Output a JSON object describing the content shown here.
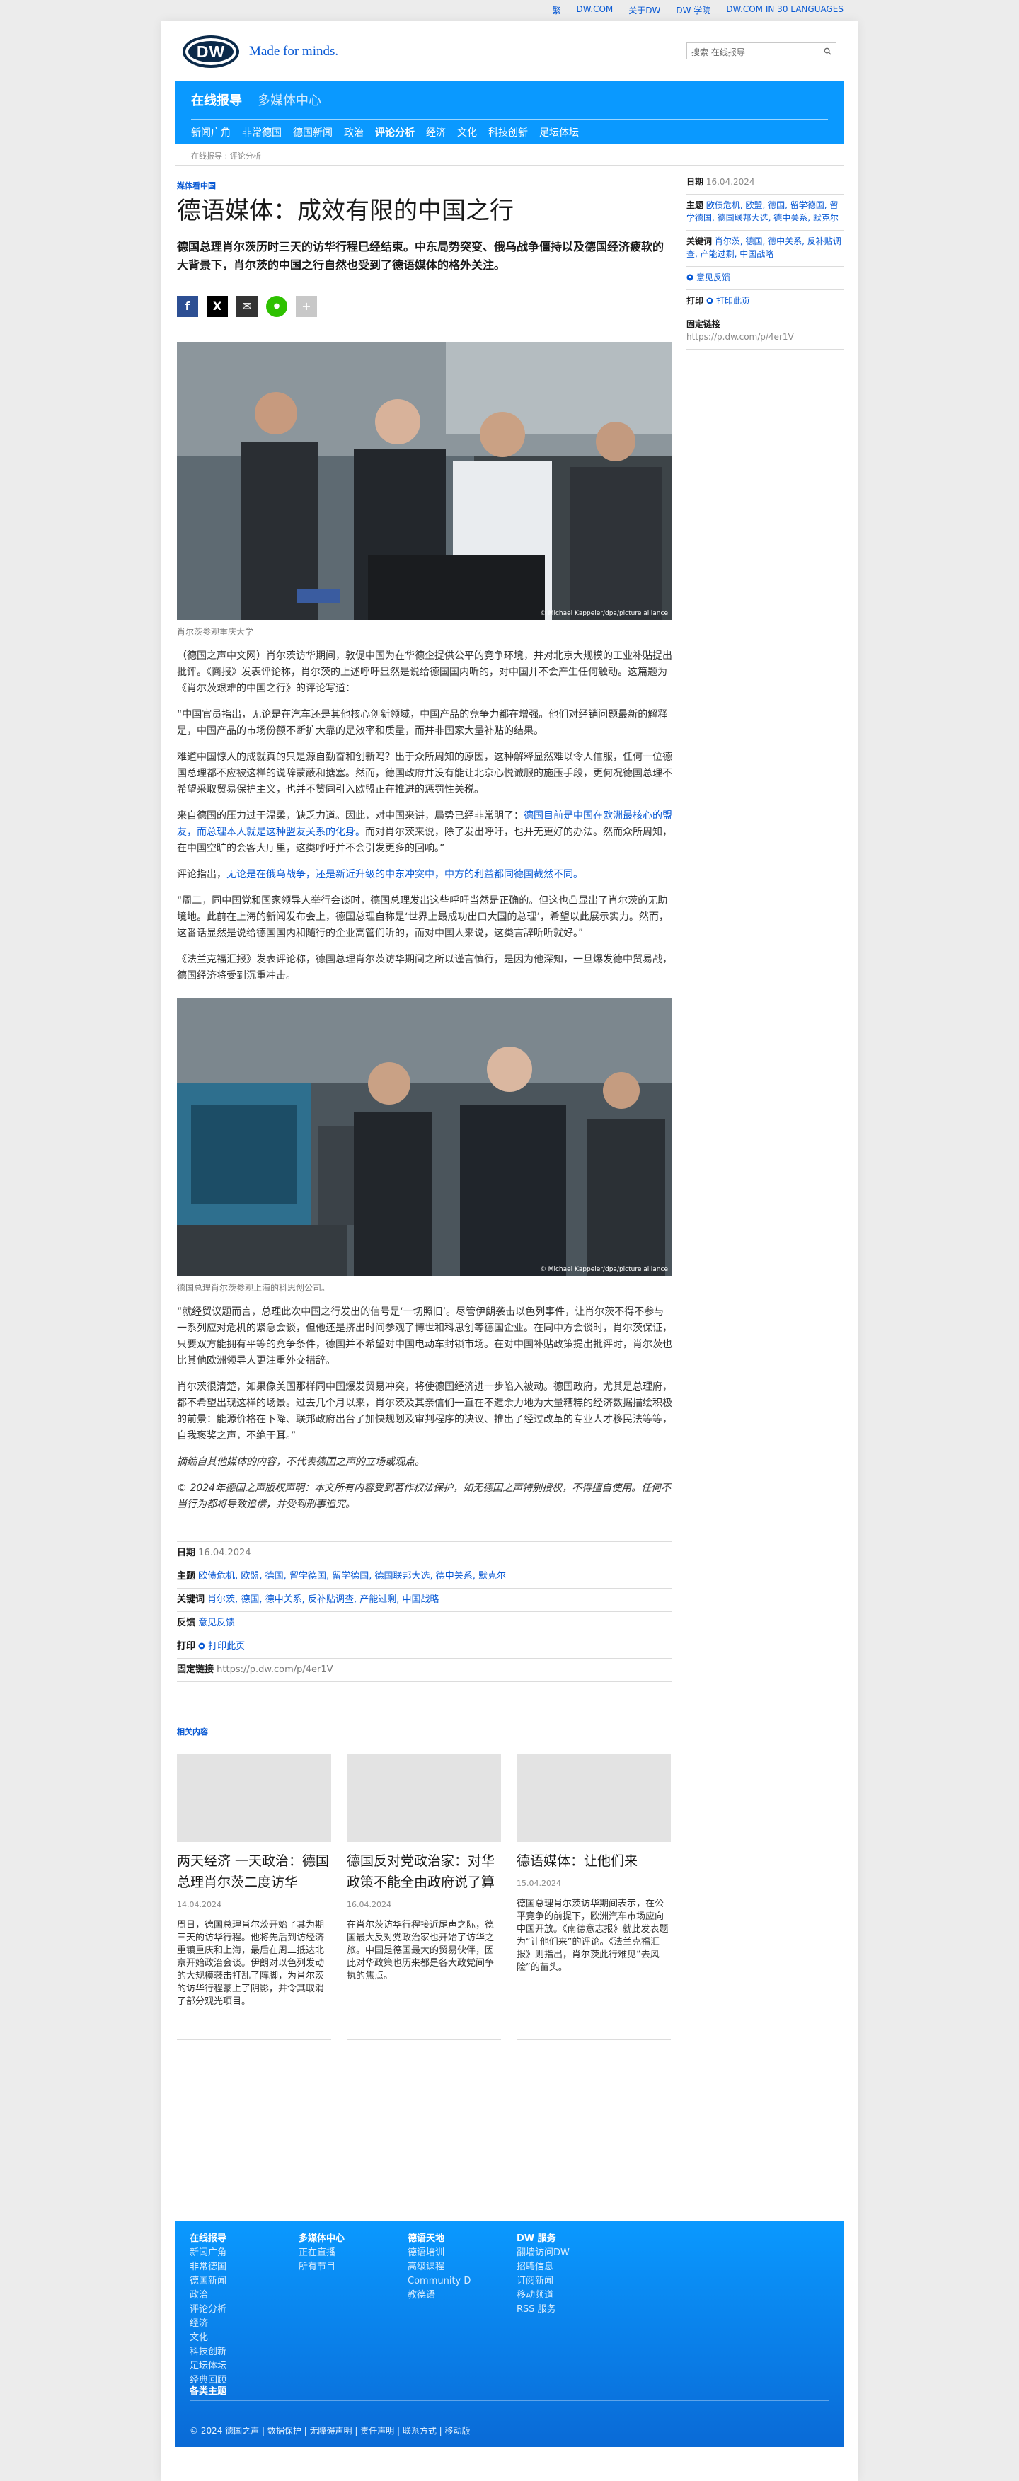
{
  "topbar": {
    "links": [
      "繁",
      "DW.COM",
      "关于DW",
      "DW 学院",
      "DW.COM IN 30 LANGUAGES"
    ]
  },
  "header": {
    "logo_text": "DW",
    "tagline": "Made for minds.",
    "search_placeholder": "搜索 在线报导"
  },
  "nav": {
    "sections": [
      "在线报导",
      "多媒体中心"
    ],
    "items": [
      "新闻广角",
      "非常德国",
      "德国新闻",
      "政治",
      "评论分析",
      "经济",
      "文化",
      "科技创新",
      "足坛体坛"
    ]
  },
  "breadcrumb": "在线报导 : 评论分析",
  "article": {
    "kicker": "媒体看中国",
    "title": "德语媒体：成效有限的中国之行",
    "lead": "德国总理肖尔茨历时三天的访华行程已经结束。中东局势突变、俄乌战争僵持以及德国经济疲软的大背景下，肖尔茨的中国之行自然也受到了德语媒体的格外关注。",
    "share": {
      "facebook": "f",
      "x": "X",
      "email": "✉",
      "line": "●",
      "more": "+"
    },
    "photo1": {
      "credit": "© Michael Kappeler/dpa/picture alliance",
      "caption": "肖尔茨参观重庆大学"
    },
    "p1": "（德国之声中文网）肖尔茨访华期间，敦促中国为在华德企提供公平的竞争环境，并对北京大规模的工业补贴提出批评。《商报》发表评论称，肖尔茨的上述呼吁显然是说给德国国内听的，对中国并不会产生任何触动。这篇题为《肖尔茨艰难的中国之行》的评论写道：",
    "p2": "“中国官员指出，无论是在汽车还是其他核心创新领域，中国产品的竞争力都在增强。他们对经销问题最新的解释是，中国产品的市场份额不断扩大靠的是效率和质量，而并非国家大量补贴的结果。",
    "p3": "难道中国惊人的成就真的只是源自勤奋和创新吗？出于众所周知的原因，这种解释显然难以令人信服，任何一位德国总理都不应被这样的说辞蒙蔽和搪塞。然而，德国政府并没有能让北京心悦诚服的施压手段，更何况德国总理不希望采取贸易保护主义，也并不赞同引入欧盟正在推进的惩罚性关税。",
    "p4a": "来自德国的压力过于温柔，缺乏力道。因此，对中国来讲，局势已经非常明了：",
    "p4link": "德国目前是中国在欧洲最核心的盟友，而总理本人就是这种盟友关系的化身。",
    "p4b": "而对肖尔茨来说，除了发出呼吁，也并无更好的办法。然而众所周知，在中国空旷的会客大厅里，这类呼吁并不会引发更多的回响。”",
    "p5a": "评论指出，",
    "p5link": "无论是在俄乌战争，还是新近升级的中东冲突中，中方的利益都同德国截然不同。",
    "p6": "“周二，同中国党和国家领导人举行会谈时，德国总理发出这些呼吁当然是正确的。但这也凸显出了肖尔茨的无助境地。此前在上海的新闻发布会上，德国总理自称是‘世界上最成功出口大国的总理’，希望以此展示实力。然而，这番话显然是说给德国国内和随行的企业高管们听的，而对中国人来说，这类言辞听听就好。”",
    "p7": "《法兰克福汇报》发表评论称，德国总理肖尔茨访华期间之所以谨言慎行，是因为他深知，一旦爆发德中贸易战，德国经济将受到沉重冲击。",
    "photo2": {
      "credit": "© Michael Kappeler/dpa/picture alliance",
      "caption": "德国总理肖尔茨参观上海的科思创公司。"
    },
    "p8": "“就经贸议题而言，总理此次中国之行发出的信号是‘一切照旧’。尽管伊朗袭击以色列事件，让肖尔茨不得不参与一系列应对危机的紧急会谈，但他还是挤出时间参观了博世和科思创等德国企业。在同中方会谈时，肖尔茨保证，只要双方能拥有平等的竞争条件，德国并不希望对中国电动车封锁市场。在对中国补贴政策提出批评时，肖尔茨也比其他欧洲领导人更注重外交措辞。",
    "p9": "肖尔茨很清楚，如果像美国那样同中国爆发贸易冲突，将使德国经济进一步陷入被动。德国政府，尤其是总理府，都不希望出现这样的场景。过去几个月以来，肖尔茨及其亲信们一直在不遗余力地为大量糟糕的经济数据描绘积极的前景：能源价格在下降、联邦政府出台了加快规划及审判程序的决议、推出了经过改革的专业人才移民法等等，自我褒奖之声，不绝于耳。”",
    "disclaimer": "摘编自其他媒体的内容，不代表德国之声的立场或观点。",
    "copyright": "© 2024年德国之声版权声明：本文所有内容受到著作权法保护，如无德国之声特别授权，不得擅自使用。任何不当行为都将导致追偿，并受到刑事追究。"
  },
  "meta": {
    "date_label": "日期",
    "date": "16.04.2024",
    "topics_label": "主题",
    "topics": "欧债危机, 欧盟, 德国, 留学德国, 留学德国, 德国联邦大选, 德中关系, 默克尔",
    "keywords_label": "关键词",
    "keywords": "肖尔茨, 德国, 德中关系, 反补贴调查, 产能过剩, 中国战略",
    "feedback_label": "反馈",
    "feedback": "意见反馈",
    "print_label": "打印",
    "print": "打印此页",
    "permalink_label": "固定链接",
    "permalink": "https://p.dw.com/p/4er1V"
  },
  "sidebar": {
    "date_label": "日期",
    "date": "16.04.2024",
    "topics_label": "主题",
    "topics": "欧债危机, 欧盟, 德国, 留学德国, 留学德国, 德国联邦大选, 德中关系, 默克尔",
    "keywords_label": "关键词",
    "keywords": "肖尔茨, 德国, 德中关系, 反补贴调查, 产能过剩, 中国战略",
    "feedback": "意见反馈",
    "print_label": "打印",
    "print": "打印此页",
    "permalink_label": "固定链接",
    "permalink": "https://p.dw.com/p/4er1V"
  },
  "related": {
    "title": "相关内容",
    "cards": [
      {
        "title": "两天经济 一天政治：德国总理肖尔茨二度访华",
        "date": "14.04.2024",
        "text": "周日，德国总理肖尔茨开始了其为期三天的访华行程。他将先后到访经济重镇重庆和上海，最后在周二抵达北京开始政治会谈。伊朗对以色列发动的大规模袭击打乱了阵脚，为肖尔茨的访华行程蒙上了阴影，并令其取消了部分观光项目。"
      },
      {
        "title": "德国反对党政治家：对华政策不能全由政府说了算",
        "date": "16.04.2024",
        "text": "在肖尔茨访华行程接近尾声之际，德国最大反对党政治家也开始了访华之旅。中国是德国最大的贸易伙伴，因此对华政策也历来都是各大政党间争执的焦点。"
      },
      {
        "title": "德语媒体：让他们来",
        "date": "15.04.2024",
        "text": "德国总理肖尔茨访华期间表示，在公平竞争的前提下，欧洲汽车市场应向中国开放。《南德意志报》就此发表题为“让他们来”的评论。《法兰克福汇报》则指出，肖尔茨此行难见“去风险”的苗头。"
      }
    ]
  },
  "footer": {
    "col1": {
      "heading": "在线报导",
      "items": [
        "新闻广角",
        "非常德国",
        "德国新闻",
        "政治",
        "评论分析",
        "经济",
        "文化",
        "科技创新",
        "足坛体坛",
        "经典回顾"
      ]
    },
    "col2": {
      "heading": "多媒体中心",
      "items": [
        "正在直播",
        "所有节目"
      ]
    },
    "col3": {
      "heading": "德语天地",
      "items": [
        "德语培训",
        "高级课程",
        "Community D",
        "教德语"
      ]
    },
    "col4": {
      "heading": "DW 服务",
      "items": [
        "翻墙访问DW",
        "招聘信息",
        "订阅新闻",
        "移动频道",
        "RSS 服务"
      ]
    },
    "all_topics": "各类主题",
    "bottom": "© 2024 德国之声 | 数据保护 | 无障碍声明 | 责任声明 | 联系方式 | 移动版"
  },
  "colors": {
    "brand_blue": "#0a99ff",
    "link_blue": "#0a5ad4",
    "logo_navy": "#0b2a4a"
  }
}
